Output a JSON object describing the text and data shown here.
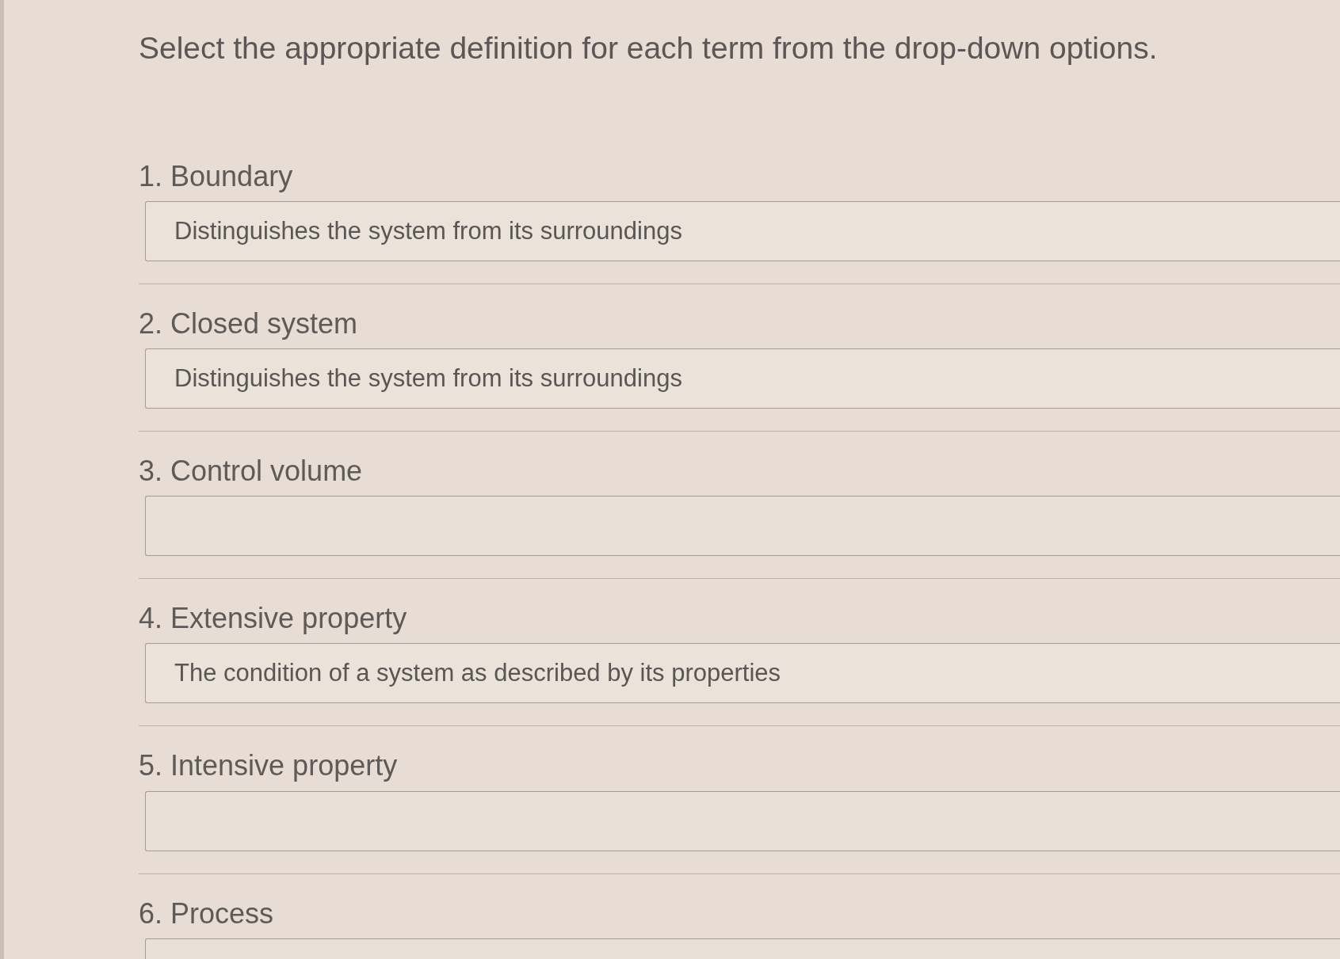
{
  "instruction": "Select the appropriate definition for each term from the drop-down options.",
  "questions": [
    {
      "number": "1.",
      "term": "Boundary",
      "value": "Distinguishes the system from its surroundings"
    },
    {
      "number": "2.",
      "term": "Closed system",
      "value": "Distinguishes the system from its surroundings"
    },
    {
      "number": "3.",
      "term": "Control volume"
    },
    {
      "number": "4.",
      "term": "Extensive property",
      "value": "The condition of a system as described by its properties"
    },
    {
      "number": "5.",
      "term": "Intensive property"
    },
    {
      "number": "6.",
      "term": "Process"
    }
  ]
}
